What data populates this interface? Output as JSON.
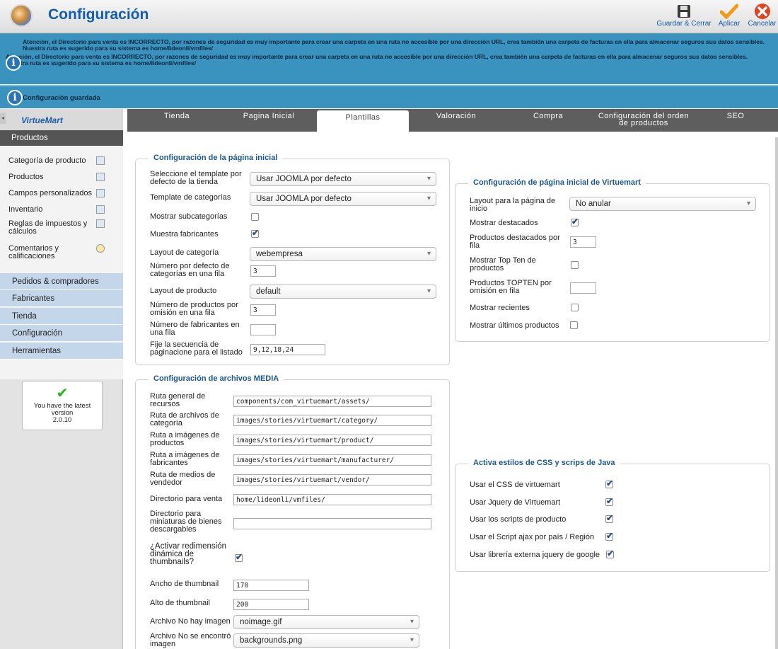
{
  "header": {
    "title": "Configuración",
    "buttons": {
      "save": "Guardar & Cerrar",
      "apply": "Aplicar",
      "cancel": "Cancelar"
    }
  },
  "messages": {
    "warning1": "Atención, el Directorio para venta es INCORRECTO, por razones de seguridad es muy importante para crear una carpeta en una ruta no accesible por una dirección URL, crea también una carpeta de facturas en ella para almacenar seguros sus datos sensibles. Nuestra ruta es sugerido para su sistema es home/lideonli/vmfiles/",
    "warning2": "Atención, el Directorio para venta es INCORRECTO, por razones de seguridad es muy importante para crear una carpeta en una ruta no accesible por una dirección URL, crea también una carpeta de facturas en ella para almacenar seguros sus datos sensibles. Nuestra ruta es sugerido para su sistema es home/lideonli/vmfiles/",
    "saved": "Configuración guardada"
  },
  "sidebar": {
    "logo": "VirtueMart",
    "section": "Productos",
    "submenu": [
      "Categoría de producto",
      "Productos",
      "Campos personalizados",
      "Inventario",
      "Reglas de impuestos y cálculos",
      "Comentarios y calificaciones"
    ],
    "menu": [
      "Pedidos & compradores",
      "Fabricantes",
      "Tienda",
      "Configuración",
      "Herramientas"
    ],
    "version": {
      "line1": "You have the latest",
      "line2": "version",
      "line3": "2.0.10"
    }
  },
  "tabs": [
    "Tienda",
    "Pagina Inicial",
    "Plantillas",
    "Valoración",
    "Compra",
    "Configuración del orden de productos",
    "SEO"
  ],
  "frontpage": {
    "legend": "Configuración de la página inicial",
    "template_label": "Seleccione el template por defecto de la tienda",
    "template_value": "Usar JOOMLA por defecto",
    "cat_template_label": "Template de categorías",
    "cat_template_value": "Usar JOOMLA por defecto",
    "show_subcats_label": "Mostrar subcategorías",
    "show_subcats": false,
    "show_mf_label": "Muestra fabricantes",
    "show_mf": true,
    "cat_layout_label": "Layout de categoría",
    "cat_layout_value": "webempresa",
    "cats_per_row_label": "Número por defecto de categorías en una fila",
    "cats_per_row": "3",
    "prod_layout_label": "Layout de producto",
    "prod_layout_value": "default",
    "prods_per_row_label": "Número de productos por omisión en una fila",
    "prods_per_row": "3",
    "mf_per_row_label": "Número de fabricantes en una fila",
    "mf_per_row": "",
    "pagination_label": "Fije la secuencia de paginacione para el listado",
    "pagination": "9,12,18,24"
  },
  "vmfront": {
    "legend": "Configuración de página inicial de Virtuemart",
    "layout_label": "Layout para la página de inicio",
    "layout_value": "No anular",
    "featured_label": "Mostrar destacados",
    "featured": true,
    "featured_rows_label": "Productos destacados por fila",
    "featured_rows": "3",
    "topten_label": "Mostrar Top Ten de productos",
    "topten": false,
    "topten_rows_label": "Productos TOPTEN por omisión en fila",
    "topten_rows": "",
    "recent_label": "Mostrar recientes",
    "recent": false,
    "latest_label": "Mostrar últimos productos",
    "latest": false
  },
  "media": {
    "legend": "Configuración de archivos MEDIA",
    "assets_label": "Ruta general de recursos",
    "assets": "components/com_virtuemart/assets/",
    "cat_label": "Ruta de archivos de categoría",
    "cat": "images/stories/virtuemart/category/",
    "prod_label": "Ruta a imágenes de productos",
    "prod": "images/stories/virtuemart/product/",
    "mf_label": "Ruta a imágenes de fabricantes",
    "mf": "images/stories/virtuemart/manufacturer/",
    "vendor_label": "Ruta de medios de vendedor",
    "vendor": "images/stories/virtuemart/vendor/",
    "sale_label": "Directorio para venta",
    "sale": "home/lideonli/vmfiles/",
    "thumbdir_label": "Directorio para miniaturas de bienes descargables",
    "thumbdir": "",
    "resize_label": "¿Activar redimensión dinámica de thumbnails?",
    "resize": true,
    "tw_label": "Ancho de thumbnail",
    "tw": "170",
    "th_label": "Alto de thumbnail",
    "th": "200",
    "noimg_label": "Archivo No hay imagen",
    "noimg": "noimage.gif",
    "notfound_label": "Archivo No se encontró imagen",
    "notfound": "backgrounds.png"
  },
  "css": {
    "legend": "Activa estilos de CSS y scrips de Java",
    "vmcss_label": "Usar el CSS de virtuemart",
    "vmcss": true,
    "jq_label": "Usar Jquery de Virtuemart",
    "jq": true,
    "scripts_label": "Usar los scripts de producto",
    "scripts": true,
    "ajax_label": "Usar el Script ajax por país / Región",
    "ajax": true,
    "google_label": "Usar librería externa jquery de google",
    "google": true
  },
  "colors": {
    "accent": "#3993be",
    "title": "#135cae",
    "legend": "#1a5790"
  }
}
